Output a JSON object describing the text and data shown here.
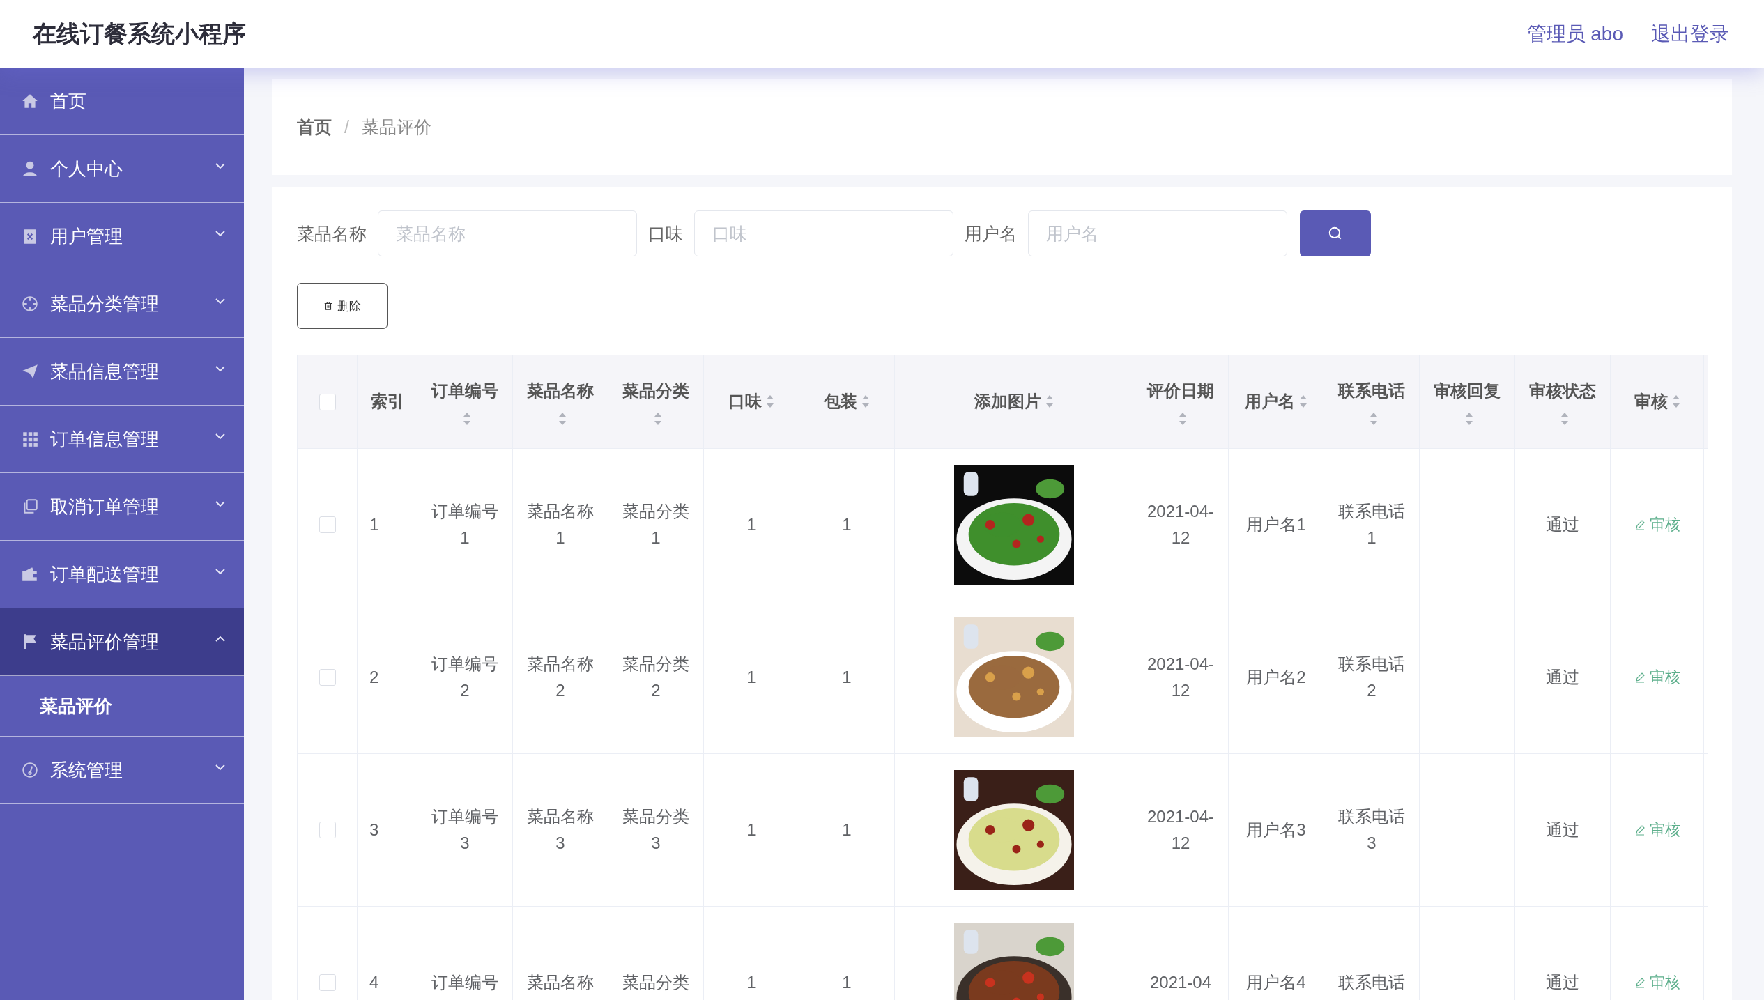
{
  "header": {
    "title": "在线订餐系统小程序",
    "user": "管理员 abo",
    "logout": "退出登录"
  },
  "sidebar": {
    "items": [
      {
        "label": "首页"
      },
      {
        "label": "个人中心",
        "expanded": false
      },
      {
        "label": "用户管理",
        "expanded": false
      },
      {
        "label": "菜品分类管理",
        "expanded": false
      },
      {
        "label": "菜品信息管理",
        "expanded": false
      },
      {
        "label": "订单信息管理",
        "expanded": false
      },
      {
        "label": "取消订单管理",
        "expanded": false
      },
      {
        "label": "订单配送管理",
        "expanded": false
      },
      {
        "label": "菜品评价管理",
        "expanded": true,
        "children": [
          {
            "label": "菜品评价",
            "selected": true
          }
        ]
      },
      {
        "label": "系统管理",
        "expanded": false
      }
    ]
  },
  "breadcrumb": [
    {
      "label": "首页",
      "selected": false
    },
    {
      "label": "菜品评价",
      "selected": true
    }
  ],
  "breadcrumb_separator": "/",
  "search": {
    "fields": [
      {
        "label": "菜品名称",
        "placeholder": "菜品名称"
      },
      {
        "label": "口味",
        "placeholder": "口味"
      },
      {
        "label": "用户名",
        "placeholder": "用户名"
      }
    ]
  },
  "delete_button": "删除",
  "table": {
    "select_all_checked": false,
    "columns": [
      {
        "label": "索引",
        "sortable": false
      },
      {
        "label": "订单编号",
        "sortable": true
      },
      {
        "label": "菜品名称",
        "sortable": true
      },
      {
        "label": "菜品分类",
        "sortable": true
      },
      {
        "label": "口味",
        "sortable": true
      },
      {
        "label": "包装",
        "sortable": true
      },
      {
        "label": "添加图片",
        "sortable": true
      },
      {
        "label": "评价日期",
        "sortable": true
      },
      {
        "label": "用户名",
        "sortable": true
      },
      {
        "label": "联系电话",
        "sortable": true
      },
      {
        "label": "审核回复",
        "sortable": true
      },
      {
        "label": "审核状态",
        "sortable": true
      },
      {
        "label": "审核",
        "sortable": true
      }
    ],
    "rows": [
      {
        "checked": false,
        "index": "1",
        "order_no": "订单编号1",
        "dish_name": "菜品名称1",
        "category": "菜品分类1",
        "taste": "1",
        "packaging": "1",
        "date": "2021-04-12",
        "username": "用户名1",
        "phone": "联系电话1",
        "status": "通过",
        "action": "审核"
      },
      {
        "checked": false,
        "index": "2",
        "order_no": "订单编号2",
        "dish_name": "菜品名称2",
        "category": "菜品分类2",
        "taste": "1",
        "packaging": "1",
        "date": "2021-04-12",
        "username": "用户名2",
        "phone": "联系电话2",
        "status": "通过",
        "action": "审核"
      },
      {
        "checked": false,
        "index": "3",
        "order_no": "订单编号3",
        "dish_name": "菜品名称3",
        "category": "菜品分类3",
        "taste": "1",
        "packaging": "1",
        "date": "2021-04-12",
        "username": "用户名3",
        "phone": "联系电话3",
        "status": "通过",
        "action": "审核"
      },
      {
        "checked": false,
        "index": "4",
        "order_no": "订单编号",
        "dish_name": "菜品名称",
        "category": "菜品分类",
        "taste": "1",
        "packaging": "1",
        "date": "2021-04",
        "username": "用户名4",
        "phone": "联系电话",
        "status": "通过",
        "action": "审核"
      }
    ]
  }
}
